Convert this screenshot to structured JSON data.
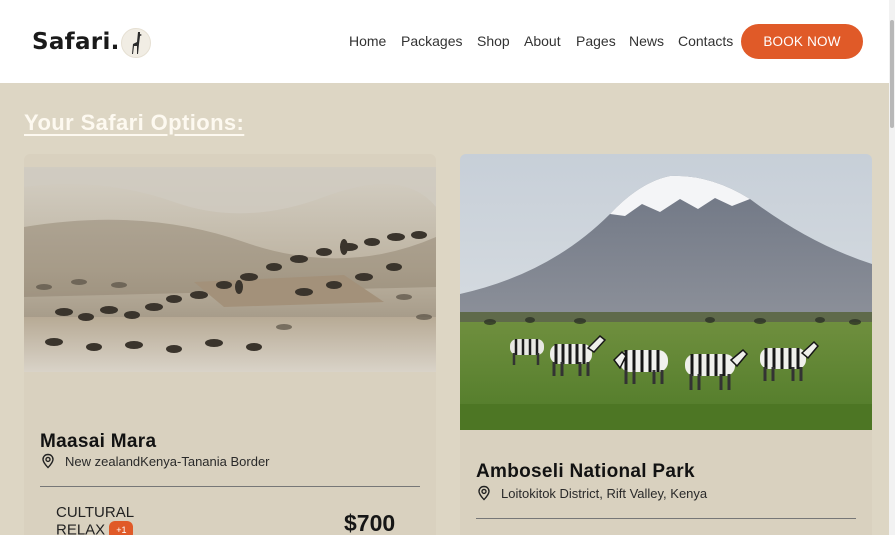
{
  "header": {
    "logo_text": "Safari.",
    "nav": [
      "Home",
      "Packages",
      "Shop",
      "About",
      "Pages",
      "News",
      "Contacts"
    ],
    "book_label": "BOOK NOW"
  },
  "section_title": "Your Safari Options:",
  "cards": [
    {
      "name": "Maasai Mara",
      "location": "New zealandKenya-Tanania Border",
      "type_label": "CULTURAL RELAX",
      "badge": "+1",
      "price": "$700"
    },
    {
      "name": "Amboseli National Park",
      "location": "Loitokitok District, Rift Valley, Kenya"
    }
  ],
  "colors": {
    "accent": "#e05a28",
    "page_bg": "#ddd6c4",
    "card_bg": "#d9d1bf"
  }
}
